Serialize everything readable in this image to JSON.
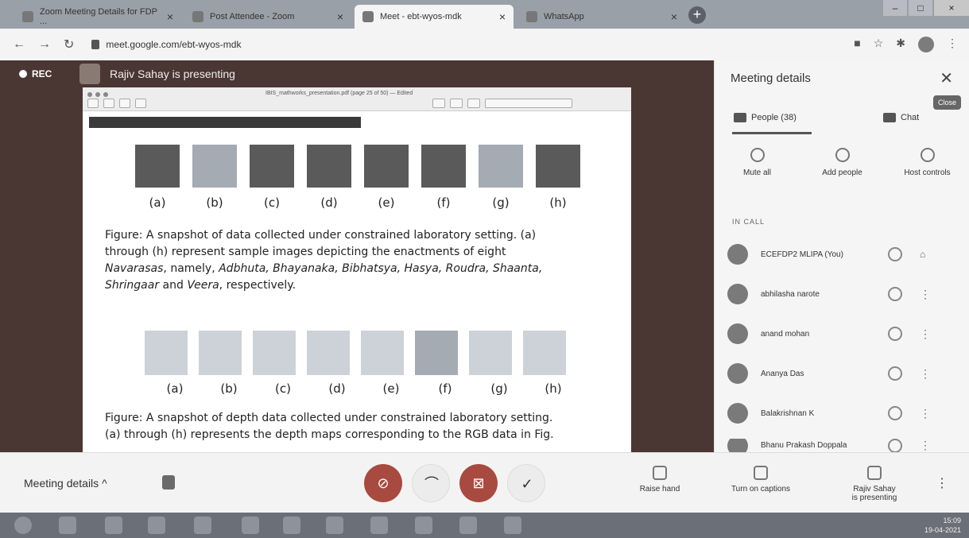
{
  "browser": {
    "tabs": [
      {
        "label": "Zoom Meeting Details for FDP ..."
      },
      {
        "label": "Post Attendee - Zoom"
      },
      {
        "label": "Meet - ebt-wyos-mdk"
      },
      {
        "label": "WhatsApp"
      }
    ],
    "url": "meet.google.com/ebt-wyos-mdk"
  },
  "stage": {
    "rec_label": "REC",
    "presenter_text": "Rajiv Sahay is presenting",
    "shared_window_title": "IBIS_mathworks_presentation.pdf (page 25 of 50) — Edited",
    "labels_row_1": [
      "(a)",
      "(b)",
      "(c)",
      "(d)",
      "(e)",
      "(f)",
      "(g)",
      "(h)"
    ],
    "labels_row_2": [
      "(a)",
      "(b)",
      "(c)",
      "(d)",
      "(e)",
      "(f)",
      "(g)",
      "(h)"
    ],
    "caption_1": {
      "l1": "Figure: A snapshot of data collected under constrained laboratory setting. (a)",
      "l2": "through (h) represent sample images depicting the enactments of eight",
      "l3_prefix": "Navarasas",
      "l3_text": ", namely, ",
      "l3_em": "Adbhuta, Bhayanaka, Bibhatsya, Hasya, Roudra, Shaanta,",
      "l4_em": "Shringaar",
      "l4_text": " and ",
      "l4_em2": "Veera",
      "l4_tail": ", respectively."
    },
    "caption_2": {
      "l1": "Figure: A snapshot of depth data collected under constrained laboratory setting.",
      "l2": "(a) through (h) represents the depth maps corresponding to the RGB data in Fig."
    }
  },
  "panel": {
    "title": "Meeting details",
    "close_tooltip": "Close",
    "tab_people": "People (38)",
    "tab_chat": "Chat",
    "actions": [
      {
        "label": "Mute all"
      },
      {
        "label": "Add people"
      },
      {
        "label": "Host controls"
      }
    ],
    "section": "IN CALL",
    "people": [
      {
        "name": "ECEFDP2 MLIPA (You)"
      },
      {
        "name": "abhilasha narote"
      },
      {
        "name": "anand mohan"
      },
      {
        "name": "Ananya Das"
      },
      {
        "name": "Balakrishnan K"
      },
      {
        "name": "Bhanu Prakash Doppala"
      }
    ]
  },
  "bottombar": {
    "meeting_details": "Meeting details",
    "raise_hand": "Raise hand",
    "captions": "Turn on captions",
    "presenting_l1": "Rajiv Sahay",
    "presenting_l2": "is presenting"
  },
  "taskbar": {
    "time": "15:09",
    "date": "19-04-2021"
  }
}
